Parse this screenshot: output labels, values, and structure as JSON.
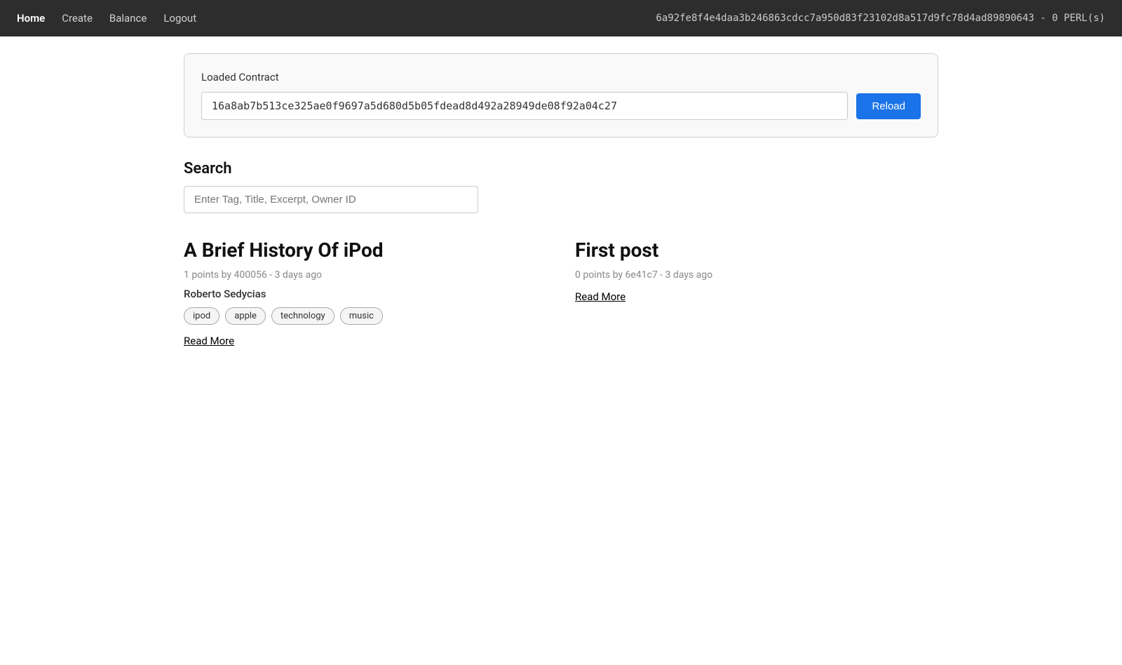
{
  "nav": {
    "items": [
      {
        "label": "Home",
        "active": true
      },
      {
        "label": "Create",
        "active": false
      },
      {
        "label": "Balance",
        "active": false
      },
      {
        "label": "Logout",
        "active": false
      }
    ],
    "account_info": "6a92fe8f4e4daa3b246863cdcc7a950d83f23102d8a517d9fc78d4ad89890643 - 0 PERL(s)"
  },
  "contract": {
    "label": "Loaded Contract",
    "value": "16a8ab7b513ce325ae0f9697a5d680d5b05fdead8d492a28949de08f92a04c27",
    "reload_label": "Reload"
  },
  "search": {
    "title": "Search",
    "placeholder": "Enter Tag, Title, Excerpt, Owner ID"
  },
  "posts": [
    {
      "title": "A Brief History Of iPod",
      "meta": "1 points by 400056 - 3 days ago",
      "author": "Roberto Sedycias",
      "tags": [
        "ipod",
        "apple",
        "technology",
        "music"
      ],
      "read_more": "Read More"
    },
    {
      "title": "First post",
      "meta": "0 points by 6e41c7 - 3 days ago",
      "author": "",
      "tags": [],
      "read_more": "Read More"
    }
  ]
}
